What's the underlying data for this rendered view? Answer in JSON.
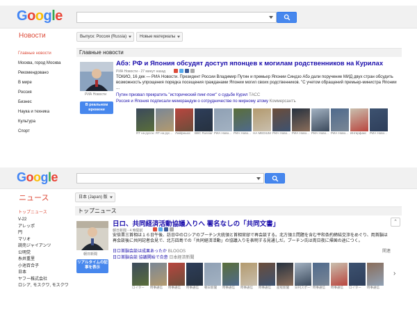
{
  "top": {
    "logo_letters": [
      "G",
      "o",
      "o",
      "g",
      "l",
      "e"
    ],
    "section_title": "Новости",
    "edition_label": "Выпуск: Россия (Russia)",
    "new_materials_label": "Новые материалы",
    "sidebar": [
      "Главные новости",
      "Москва, город Москва",
      "Рекомендовано",
      "В мире",
      "Россия",
      "Бизнес",
      "Наука и техника",
      "Культура",
      "Спорт"
    ],
    "content_header": "Главные новости",
    "headline": "Абэ: РФ и Япония обсудят доступ японцев к могилам родственников на Курилах",
    "meta_source": "РИА Новости - 27 минут назад",
    "snippet": "ТОКИО, 16 дек — РИА Новости. Президент России Владимир Путин и премьер Японии Синдзо Абэ дали поручение МИД двух стран обсудить возможность упрощения порядка посещения гражданами Японии могил своих родственников. \"С учетом обращений премьер-министра Японии ...",
    "related_1": "Путин призвал прекратить \"исторический пинг-понг\" о судьбе Курил",
    "related_1_src": "ТАСС",
    "related_2": "Россия и Япония подписали меморандум о сотрудничестве по мирному атому",
    "related_2_src": "Коммерсантъ",
    "thumb_caption": "РИА Новости",
    "realtime_button": "В реальном времени",
    "strip_captions": [
      "RT на русском",
      "RT на рус...",
      "Лайфньюс",
      "BBC Russian",
      "РИА Ново...",
      "РИА Ново...",
      "НА MEDIUM",
      "РИА Ново...",
      "РИА Ново...",
      "РИА Ново...",
      "РИА Ново...",
      "Интерфакс",
      "РИА Ново..."
    ]
  },
  "bottom": {
    "logo_letters": [
      "G",
      "o",
      "o",
      "g",
      "l",
      "e"
    ],
    "section_title": "ニュース",
    "edition_label": "日本 (Japan) 版",
    "sidebar": [
      "トップニュース",
      "V-22",
      "アレッポ",
      "円",
      "マリオ",
      "読売ジャイアンツ",
      "公明党",
      "糸井重里",
      "小池百合子",
      "日本",
      "ヤフー株式会社",
      "ロシア, モスクワ, モスクワ"
    ],
    "content_header": "トップニュース",
    "headline": "日ロ、共同経済活動協議入りへ 署名なしの「共同文書」",
    "meta_source": "朝日新聞 - 4 時間前",
    "snippet": "安倍晋三首相は１６日午後、訪日中のロシアのプーチン大統領と首相官邸で再会談する。北方領土問題を含む平和条約締結交渉をめぐり、両首脳は再会談後に共同記者会見で、北方四島での「共同経済活動」の協議入りを表明する見通しだ。プーチン氏は両日夜に帰国の途につく。",
    "related_1": "日ロ首脳会談は成果あったか",
    "related_1_src": "BLOGOS",
    "related_2": "日ロ首脳会談 協議開始で合意",
    "related_2_src": "日本経済新聞",
    "thumb_caption": "朝日新聞",
    "realtime_button": "リアルタイムの記事を表示",
    "side_label": "関連",
    "strip_captions": [
      "ロイター",
      "時事通信",
      "時事通信",
      "時事通信",
      "朝日新聞",
      "時事通信",
      "時事通信",
      "時事通信",
      "産経新聞",
      "日刊スポーツ",
      "時事通信",
      "時事通信",
      "ロイター",
      "時事通信"
    ]
  }
}
